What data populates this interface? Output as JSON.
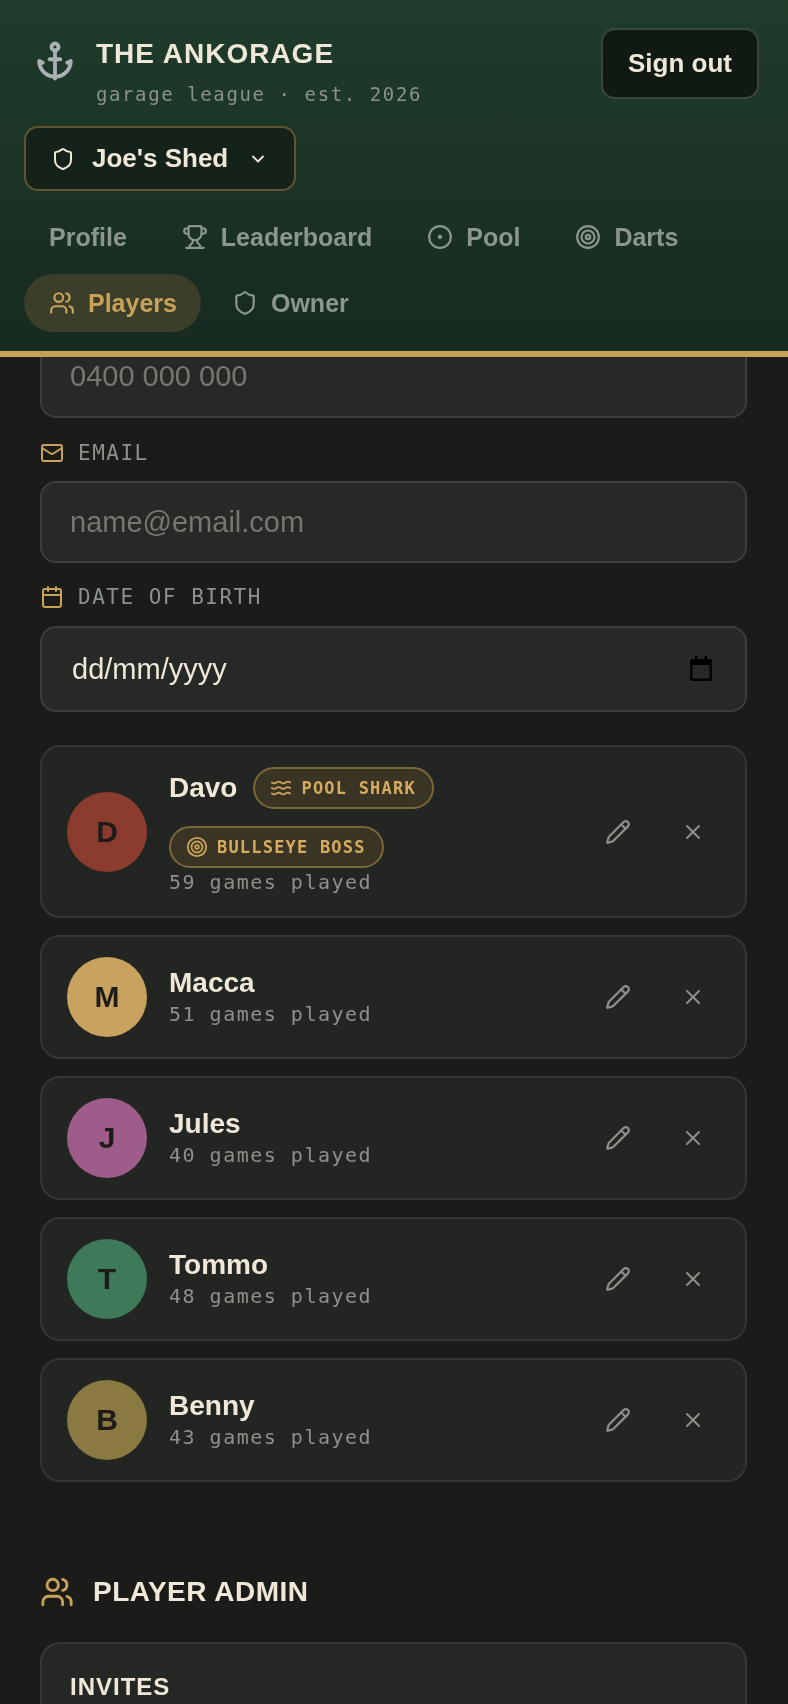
{
  "header": {
    "title": "THE ANKORAGE",
    "subtitle": "garage league · est. 2026",
    "sign_out": "Sign out"
  },
  "club_selector": {
    "label": "Joe's Shed"
  },
  "nav": [
    {
      "kind": "profile",
      "label": "Profile",
      "selected": false
    },
    {
      "kind": "leaderboard",
      "label": "Leaderboard",
      "selected": false
    },
    {
      "kind": "pool",
      "label": "Pool",
      "selected": false
    },
    {
      "kind": "darts",
      "label": "Darts",
      "selected": false
    },
    {
      "kind": "players",
      "label": "Players",
      "selected": true
    },
    {
      "kind": "owner",
      "label": "Owner",
      "selected": false
    }
  ],
  "form": {
    "phone": {
      "placeholder": "0400 000 000"
    },
    "email": {
      "label": "EMAIL",
      "placeholder": "name@email.com"
    },
    "date_of_birth": {
      "label": "DATE OF BIRTH",
      "placeholder": "dd/mm/yyyy"
    }
  },
  "players": [
    {
      "name": "Davo",
      "initial": "D",
      "color": "#8c3b2f",
      "games": "59 games played",
      "badges": [
        {
          "kind": "pool",
          "label": "POOL SHARK"
        },
        {
          "kind": "darts",
          "label": "BULLSEYE BOSS"
        }
      ]
    },
    {
      "name": "Macca",
      "initial": "M",
      "color": "#c8a25e",
      "games": "51 games played"
    },
    {
      "name": "Jules",
      "initial": "J",
      "color": "#9e5c8b",
      "games": "40 games played"
    },
    {
      "name": "Tommo",
      "initial": "T",
      "color": "#3e7a5a",
      "games": "48 games played"
    },
    {
      "name": "Benny",
      "initial": "B",
      "color": "#8a7a42",
      "games": "43 games played"
    }
  ],
  "admin": {
    "title": "PLAYER ADMIN",
    "invites": {
      "title": "INVITES"
    }
  }
}
